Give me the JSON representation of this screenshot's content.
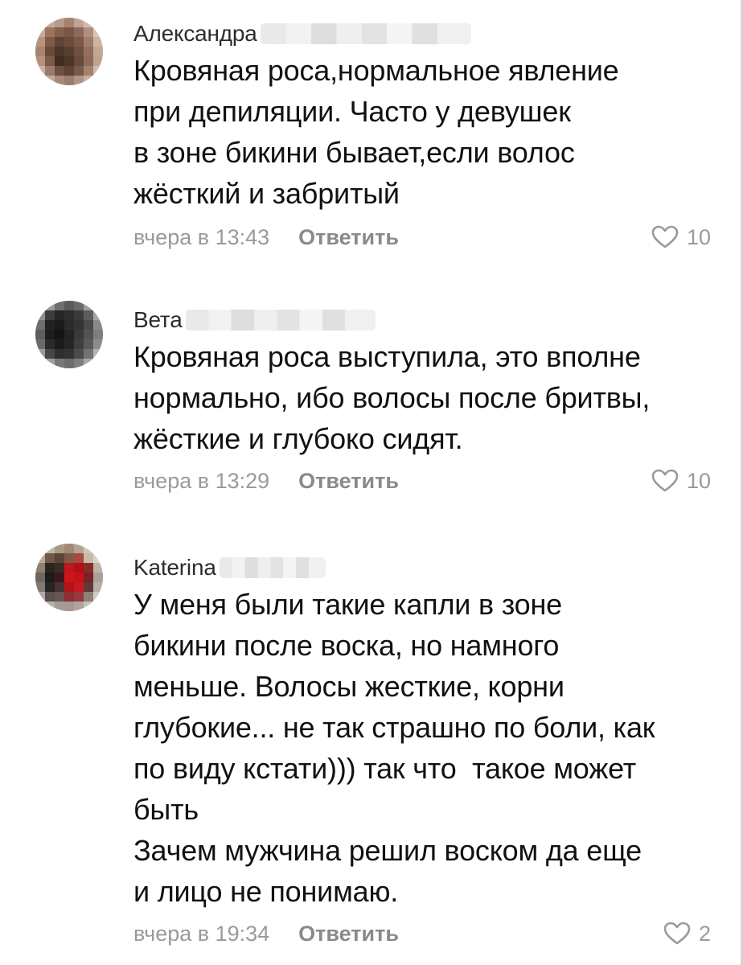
{
  "comments": [
    {
      "author": "Александра",
      "text": "Кровяная роса,нормальное явление\nпри депиляции. Часто у девушек\nв зоне бикини бывает,если волос\nжёсткий и забритый",
      "time": "вчера в 13:43",
      "reply_label": "Ответить",
      "likes": "10"
    },
    {
      "author": "Вета",
      "text": "Кровяная роса выступила, это вполне\nнормально, ибо волосы после бритвы,\nжёсткие и глубоко сидят.",
      "time": "вчера в 13:29",
      "reply_label": "Ответить",
      "likes": "10"
    },
    {
      "author": "Katerina",
      "text": "У меня были такие капли в зоне\nбикини после воска, но намного\nменьше. Волосы жесткие, корни\nглубокие... не так страшно по боли, как\nпо виду кстати))) так что  такое может\nбыть\nЗачем мужчина решил воском да еще\nи лицо не понимаю.",
      "time": "вчера в 19:34",
      "reply_label": "Ответить",
      "likes": "2"
    }
  ],
  "colors": {
    "text": "#111111",
    "author": "#2c2c2c",
    "meta": "#9a9a9a",
    "reply": "#8a8a8a"
  },
  "icons": {
    "like": "heart-outline-icon"
  }
}
